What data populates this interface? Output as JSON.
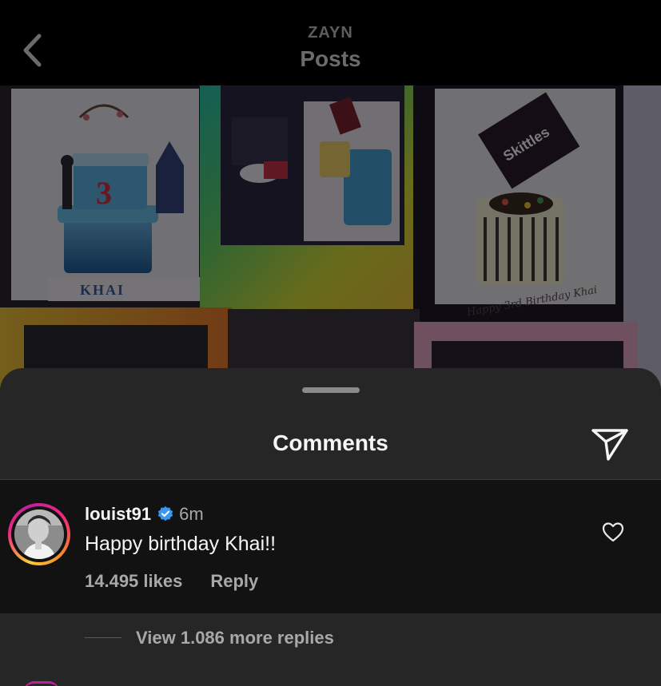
{
  "header": {
    "account": "ZAYN",
    "title": "Posts",
    "back_icon": "chevron-left-icon"
  },
  "post": {
    "cake_text_left": "KHAI",
    "cake_number": "3",
    "candy_box_text": "Skittles",
    "cake_text_right": "Happy 3rd Birthday Khai"
  },
  "sheet": {
    "title": "Comments",
    "share_icon": "paper-plane-icon"
  },
  "comment": {
    "username": "louist91",
    "verified": true,
    "time": "6m",
    "text": "Happy birthday Khai!!",
    "likes": "14.495 likes",
    "reply_label": "Reply",
    "like_icon": "heart-outline-icon"
  },
  "replies": {
    "label": "View 1.086 more replies"
  },
  "colors": {
    "sheet_bg": "#262626",
    "comment_bg": "#121212",
    "verified_blue": "#3897f0",
    "secondary_text": "#a8a8a8"
  }
}
